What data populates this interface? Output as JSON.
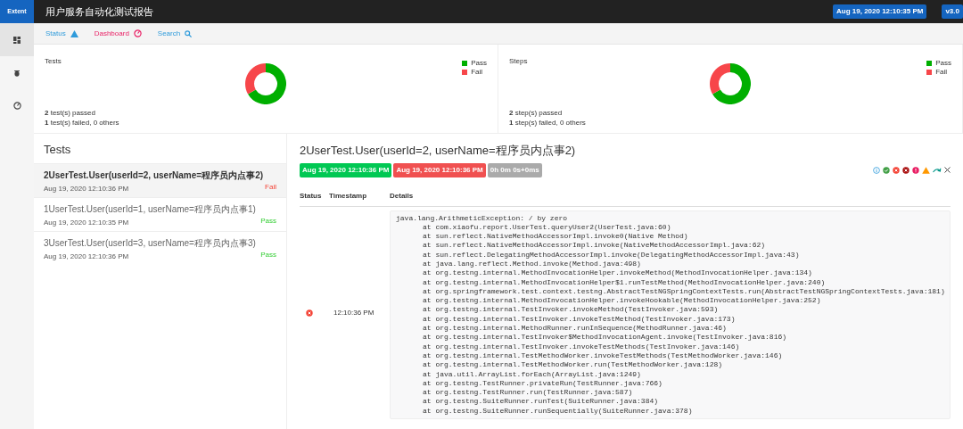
{
  "brand": "Extent",
  "report_title": "用户服务自动化测试报告",
  "top_badges": [
    {
      "text": "Aug 19, 2020 12:10:35 PM"
    },
    {
      "text": "v3.0"
    }
  ],
  "sidebar": {
    "items": [
      {
        "kind": "dashboard",
        "selected": true
      },
      {
        "kind": "bug",
        "selected": false
      },
      {
        "kind": "dial",
        "selected": false
      }
    ]
  },
  "nav": [
    {
      "label": "Status",
      "kind": "status",
      "selected": false
    },
    {
      "label": "Dashboard",
      "kind": "dashboard",
      "selected": true
    },
    {
      "label": "Search",
      "kind": "search",
      "selected": false
    }
  ],
  "cards": [
    {
      "chart_data": {
        "type": "donut",
        "title": "Tests",
        "categories": [
          "Pass",
          "Fail"
        ],
        "series": [
          {
            "values": [
              66.7,
              33.3
            ]
          }
        ]
      },
      "legend": [
        {
          "color": "#00af00"
        },
        {
          "color": "#f7464a"
        }
      ],
      "summary": [
        "**2** test(s) passed",
        "**1** test(s) failed, 0 others"
      ]
    },
    {
      "chart_data": {
        "type": "donut",
        "title": "Steps",
        "categories": [
          "Pass",
          "Fail"
        ],
        "series": [
          {
            "values": [
              66.7,
              33.3
            ]
          }
        ]
      },
      "legend": [
        {
          "color": "#00af00"
        },
        {
          "color": "#f7464a"
        }
      ],
      "summary": [
        "**2** step(s) passed",
        "**1** step(s) failed, 0 others"
      ]
    }
  ],
  "tests": {
    "heading": "Tests",
    "items": [
      {
        "name": "2UserTest.User(userId=2, userName=程序员内点事2)",
        "time": "Aug 19, 2020 12:10:36 PM",
        "status": "Fail",
        "kind": "fail",
        "selected": true
      },
      {
        "name": "1UserTest.User(userId=1, userName=程序员内点事1)",
        "time": "Aug 19, 2020 12:10:35 PM",
        "status": "Pass",
        "kind": "pass",
        "selected": false
      },
      {
        "name": "3UserTest.User(userId=3, userName=程序员内点事3)",
        "time": "Aug 19, 2020 12:10:36 PM",
        "status": "Pass",
        "kind": "pass",
        "selected": false
      }
    ]
  },
  "detail": {
    "title": "2UserTest.User(userId=2, userName=程序员内点事2)",
    "badges": [
      {
        "text": "Aug 19, 2020 12:10:36 PM",
        "kind": "start"
      },
      {
        "text": "Aug 19, 2020 12:10:36 PM",
        "kind": "end"
      },
      {
        "text": "0h 0m 0s+0ms",
        "kind": "duration"
      }
    ],
    "filters": [
      {
        "kind": "info"
      },
      {
        "kind": "pass"
      },
      {
        "kind": "fail"
      },
      {
        "kind": "fatal"
      },
      {
        "kind": "error"
      },
      {
        "kind": "warning"
      },
      {
        "kind": "skip"
      },
      {
        "kind": "clear"
      }
    ],
    "columns": [
      "Status",
      "Timestamp",
      "Details"
    ],
    "logs": [
      {
        "kind": "fail",
        "timestamp": "12:10:36 PM",
        "lines": [
          "java.lang.ArithmeticException: / by zero",
          "at com.xiaofu.report.UserTest.queryUser2(UserTest.java:60)",
          "at sun.reflect.NativeMethodAccessorImpl.invoke0(Native Method)",
          "at sun.reflect.NativeMethodAccessorImpl.invoke(NativeMethodAccessorImpl.java:62)",
          "at sun.reflect.DelegatingMethodAccessorImpl.invoke(DelegatingMethodAccessorImpl.java:43)",
          "at java.lang.reflect.Method.invoke(Method.java:498)",
          "at org.testng.internal.MethodInvocationHelper.invokeMethod(MethodInvocationHelper.java:134)",
          "at org.testng.internal.MethodInvocationHelper$1.runTestMethod(MethodInvocationHelper.java:240)",
          "at org.springframework.test.context.testng.AbstractTestNGSpringContextTests.run(AbstractTestNGSpringContextTests.java:181)",
          "at org.testng.internal.MethodInvocationHelper.invokeHookable(MethodInvocationHelper.java:252)",
          "at org.testng.internal.TestInvoker.invokeMethod(TestInvoker.java:593)",
          "at org.testng.internal.TestInvoker.invokeTestMethod(TestInvoker.java:173)",
          "at org.testng.internal.MethodRunner.runInSequence(MethodRunner.java:46)",
          "at org.testng.internal.TestInvoker$MethodInvocationAgent.invoke(TestInvoker.java:816)",
          "at org.testng.internal.TestInvoker.invokeTestMethods(TestInvoker.java:146)",
          "at org.testng.internal.TestMethodWorker.invokeTestMethods(TestMethodWorker.java:146)",
          "at org.testng.internal.TestMethodWorker.run(TestMethodWorker.java:128)",
          "at java.util.ArrayList.forEach(ArrayList.java:1249)",
          "at org.testng.TestRunner.privateRun(TestRunner.java:766)",
          "at org.testng.TestRunner.run(TestRunner.java:587)",
          "at org.testng.SuiteRunner.runTest(SuiteRunner.java:384)",
          "at org.testng.SuiteRunner.runSequentially(SuiteRunner.java:378)"
        ]
      }
    ]
  }
}
